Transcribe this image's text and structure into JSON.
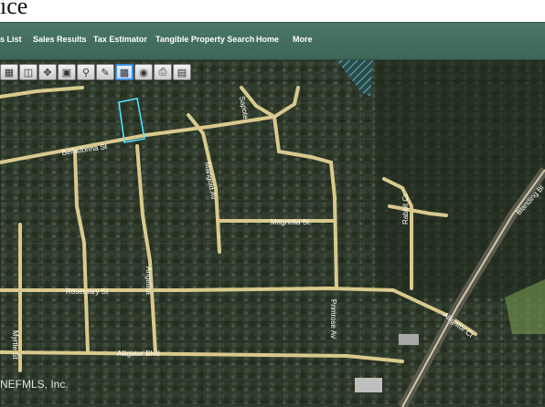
{
  "header": {
    "title_fragment": "ice"
  },
  "nav": {
    "items": [
      {
        "label": "s List"
      },
      {
        "label": "Sales Results"
      },
      {
        "label": "Tax Estimator"
      },
      {
        "label": "Tangible Property Search"
      },
      {
        "label": "Home"
      },
      {
        "label": "More"
      }
    ]
  },
  "toolbar": {
    "tools": [
      {
        "icon": "layers-icon"
      },
      {
        "icon": "map-icon"
      },
      {
        "icon": "pan-icon"
      },
      {
        "icon": "parcel-icon"
      },
      {
        "icon": "zoom-icon"
      },
      {
        "icon": "draw-icon"
      },
      {
        "icon": "select-icon"
      },
      {
        "icon": "binoculars-icon"
      },
      {
        "icon": "print-icon"
      },
      {
        "icon": "save-icon"
      }
    ]
  },
  "map": {
    "streets": {
      "belladonna": "Belladonna St",
      "mangold": "Mangold Av",
      "sapote": "Sapote",
      "magnolia": "Magnolia St",
      "rabbit": "Rabbit Ct",
      "blanding": "Blanding Bl",
      "rosemary": "Rosemary St",
      "primrose": "Primrose Av",
      "alligator_ct": "Alligator Ct",
      "myrtle": "Myrtle St",
      "angelica": "Angelica",
      "alligator_blvd": "Alligator Blvd"
    },
    "watermark": "NEFMLS, Inc.",
    "highlight_color": "#4fe3ff"
  }
}
